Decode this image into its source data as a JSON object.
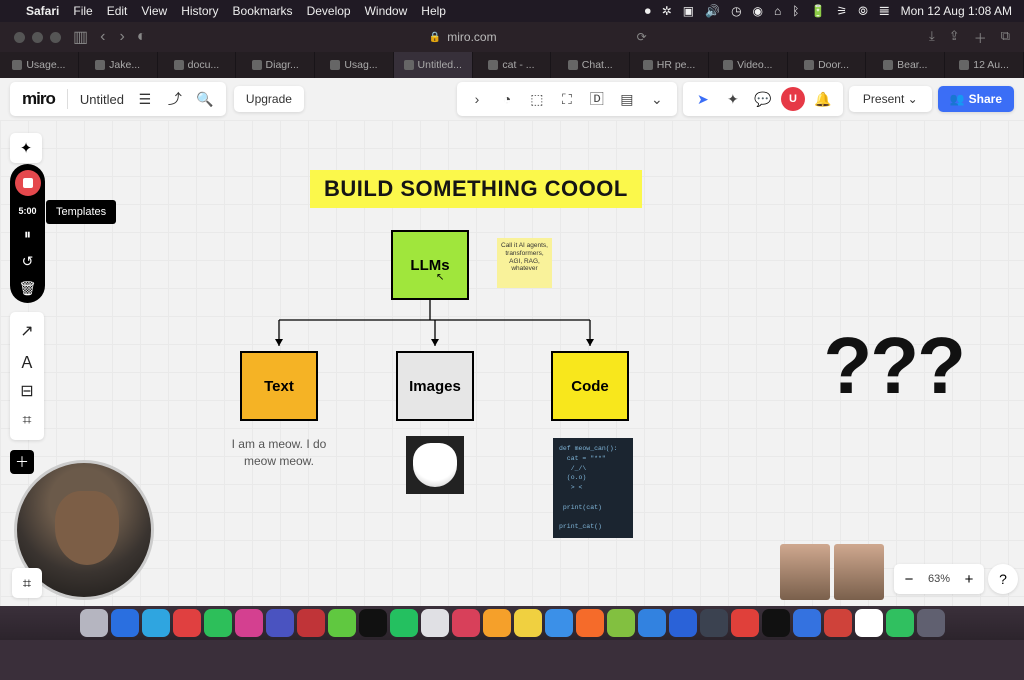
{
  "menubar": {
    "app": "Safari",
    "items": [
      "File",
      "Edit",
      "View",
      "History",
      "Bookmarks",
      "Develop",
      "Window",
      "Help"
    ],
    "clock": "Mon 12 Aug 1:08 AM"
  },
  "browser": {
    "url_host": "miro.com",
    "tabs": [
      "Usage...",
      "Jake...",
      "docu...",
      "Diagr...",
      "Usag...",
      "Untitled...",
      "cat - ...",
      "Chat...",
      "HR pe...",
      "Video...",
      "Door...",
      "Bear...",
      "12 Au..."
    ]
  },
  "miro": {
    "logo": "miro",
    "board_title": "Untitled",
    "upgrade": "Upgrade",
    "present": "Present",
    "share": "Share",
    "avatar_initial": "U"
  },
  "recording": {
    "time": "5:00",
    "templates_tooltip": "Templates"
  },
  "canvas": {
    "heading": "BUILD SOMETHING COOOL",
    "llms": "LLMs",
    "sticky": "Call it AI agents, transformers, AGI, RAG, whatever",
    "text_box": "Text",
    "images_box": "Images",
    "code_box": "Code",
    "meow": "I am a meow. I do meow meow.",
    "code_snippet": "def meow_can():\n  cat = \"**\"\n   /_/\\\n  (o.o)\n   > <\n\n print(cat)\n\nprint_cat()",
    "question_marks": "???"
  },
  "zoom": {
    "value": "63%"
  },
  "dock_colors": [
    "#b5b5c0",
    "#2a6fe0",
    "#2fa5e0",
    "#e04040",
    "#2dbf5a",
    "#d44090",
    "#4a53c0",
    "#c03438",
    "#60c840",
    "#111",
    "#24c060",
    "#e0e0e4",
    "#d8405a",
    "#f5a02a",
    "#f0d040",
    "#3b90e8",
    "#f56b2a",
    "#82c040",
    "#3282e0",
    "#2a62d8",
    "#3b4250",
    "#e0403a",
    "#111",
    "#3472e0",
    "#cf423a",
    "#fff",
    "#30c060",
    "#606070"
  ]
}
